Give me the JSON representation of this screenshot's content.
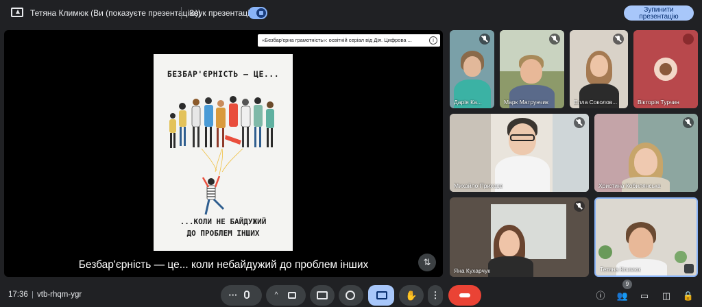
{
  "topbar": {
    "presenter_text": "Тетяна Климюк (Ви (показуєте презентацію))",
    "sound_label": "Звук презентації",
    "stop_button": "Зупинити презентацію"
  },
  "presentation": {
    "video_title": "«Безбар'єрна грамотність»: освітній серіал від Дія. Цифрова ...",
    "poster_top_text": "БЕЗБАР'ЄРНІСТЬ — ЦЕ...",
    "poster_bottom_line1": "...КОЛИ НЕ БАЙДУЖИЙ",
    "poster_bottom_line2": "ДО ПРОБЛЕМ ІНШИХ",
    "subtitle": "Безбар'єрність — це... коли небайдужий до проблем інших"
  },
  "participants": [
    {
      "name": "Дарія Ка..."
    },
    {
      "name": "Марк Матрунчик"
    },
    {
      "name": "Елла Соколов..."
    },
    {
      "name": "Вікторія Турчин"
    },
    {
      "name": "Михайло Приходa"
    },
    {
      "name": "Христина Кобилянська"
    },
    {
      "name": "Яна Кухарчук"
    },
    {
      "name": "Тетяна Климюк"
    }
  ],
  "bottombar": {
    "time": "17:36",
    "separator": "|",
    "meeting_code": "vtb-rhqm-ygr",
    "participants_count": "9"
  },
  "icons": {
    "more": "more-horizontal-icon",
    "mic": "mic-icon",
    "camera": "camera-icon",
    "captions": "captions-icon",
    "emoji": "emoji-icon",
    "present": "present-icon",
    "hand": "raise-hand-icon",
    "leave": "leave-call-icon"
  }
}
